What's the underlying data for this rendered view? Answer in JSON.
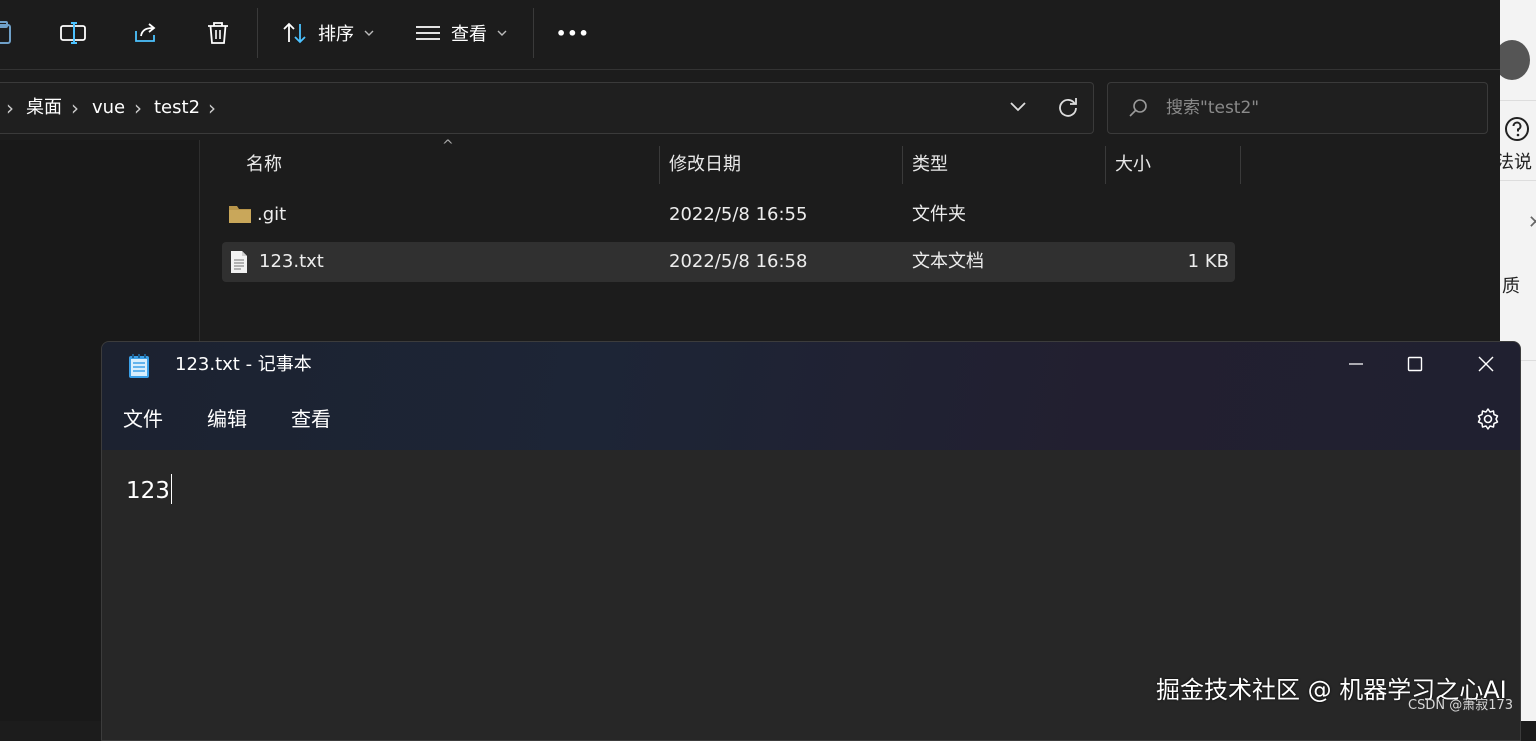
{
  "toolbar": {
    "sort_label": "排序",
    "view_label": "查看",
    "more_label": "•••"
  },
  "address": {
    "crumbs": [
      "桌面",
      "vue",
      "test2"
    ],
    "separator": "›"
  },
  "search": {
    "placeholder": "搜索\"test2\""
  },
  "file_list": {
    "columns": [
      "名称",
      "修改日期",
      "类型",
      "大小"
    ],
    "sort_indicator": "^",
    "rows": [
      {
        "name": ".git",
        "modified": "2022/5/8 16:55",
        "type": "文件夹",
        "size": "",
        "icon": "folder-icon",
        "selected": false
      },
      {
        "name": "123.txt",
        "modified": "2022/5/8 16:58",
        "type": "文本文档",
        "size": "1 KB",
        "icon": "text-file-icon",
        "selected": true
      }
    ]
  },
  "right_strip": {
    "labels": [
      "法说",
      "质"
    ]
  },
  "notepad": {
    "title": "123.txt - 记事本",
    "menu": [
      "文件",
      "编辑",
      "查看"
    ],
    "content": "123"
  },
  "watermark": {
    "main": "掘金技术社区 @ 机器学习之心AI",
    "sub": "CSDN @萧寂173"
  },
  "colors": {
    "accent": "#4cc2ff",
    "folder": "#c9a75a",
    "background": "#1c1c1c"
  }
}
